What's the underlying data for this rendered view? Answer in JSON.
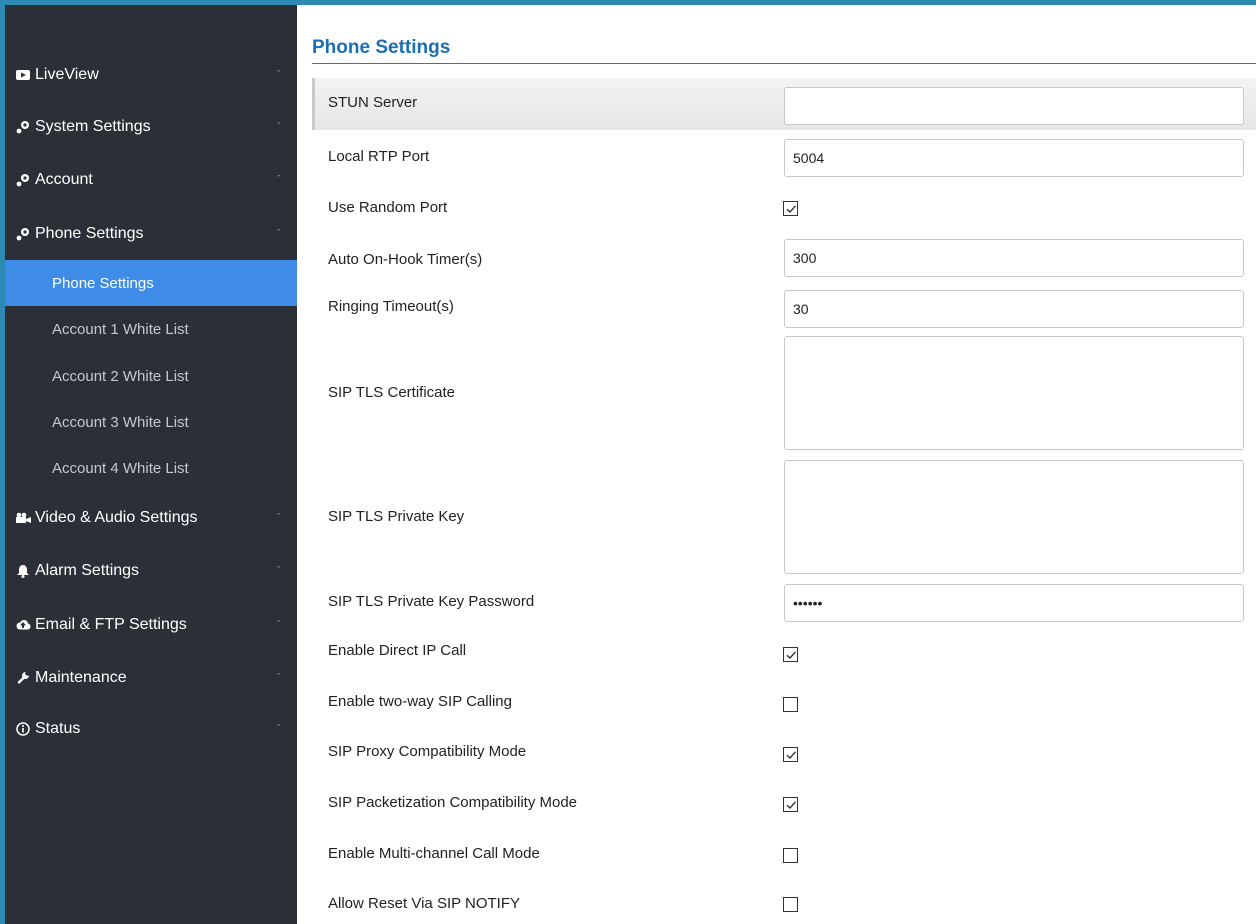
{
  "sidebar": {
    "menu": [
      {
        "label": "LiveView",
        "icon": "video-icon",
        "expanded": false
      },
      {
        "label": "System Settings",
        "icon": "settings-icon",
        "expanded": false
      },
      {
        "label": "Account",
        "icon": "settings-icon",
        "expanded": true
      },
      {
        "label": "Phone Settings",
        "icon": "settings-icon",
        "expanded": true
      },
      {
        "label": "Video & Audio Settings",
        "icon": "camera-icon",
        "expanded": false
      },
      {
        "label": "Alarm Settings",
        "icon": "bell-icon",
        "expanded": false
      },
      {
        "label": "Email & FTP Settings",
        "icon": "cloud-icon",
        "expanded": false
      },
      {
        "label": "Maintenance",
        "icon": "wrench-icon",
        "expanded": false
      },
      {
        "label": "Status",
        "icon": "info-icon",
        "expanded": false
      }
    ],
    "submenu": [
      {
        "label": "Phone Settings",
        "active": true
      },
      {
        "label": "Account 1 White List",
        "active": false
      },
      {
        "label": "Account 2 White List",
        "active": false
      },
      {
        "label": "Account 3 White List",
        "active": false
      },
      {
        "label": "Account 4 White List",
        "active": false
      }
    ],
    "chevron_collapsed": "ˇ",
    "chevron_expanded": "ˆ"
  },
  "main": {
    "title": "Phone Settings",
    "fields": {
      "stun_server": {
        "label": "STUN Server",
        "value": ""
      },
      "local_rtp_port": {
        "label": "Local RTP Port",
        "value": "5004"
      },
      "use_random_port": {
        "label": "Use Random Port",
        "checked": true
      },
      "auto_on_hook_timer": {
        "label": "Auto On-Hook Timer(s)",
        "value": "300"
      },
      "ringing_timeout": {
        "label": "Ringing Timeout(s)",
        "value": "30"
      },
      "sip_tls_certificate": {
        "label": "SIP TLS Certificate",
        "value": ""
      },
      "sip_tls_private_key": {
        "label": "SIP TLS Private Key",
        "value": ""
      },
      "sip_tls_private_key_password": {
        "label": "SIP TLS Private Key Password",
        "value": "••••••"
      },
      "enable_direct_ip_call": {
        "label": "Enable Direct IP Call",
        "checked": true
      },
      "enable_two_way_sip_calling": {
        "label": "Enable two-way SIP Calling",
        "checked": false
      },
      "sip_proxy_compatibility_mode": {
        "label": "SIP Proxy Compatibility Mode",
        "checked": true
      },
      "sip_packetization_compatibility_mode": {
        "label": "SIP Packetization Compatibility Mode",
        "checked": true
      },
      "enable_multi_channel_call_mode": {
        "label": "Enable Multi-channel Call Mode",
        "checked": false
      },
      "allow_reset_via_sip_notify": {
        "label": "Allow Reset Via SIP NOTIFY",
        "checked": false
      }
    }
  },
  "colors": {
    "sidebar_bg": "#2b3038",
    "active_item": "#3f8be8",
    "title": "#1a6fb5",
    "frame": "#2d8ab5"
  }
}
